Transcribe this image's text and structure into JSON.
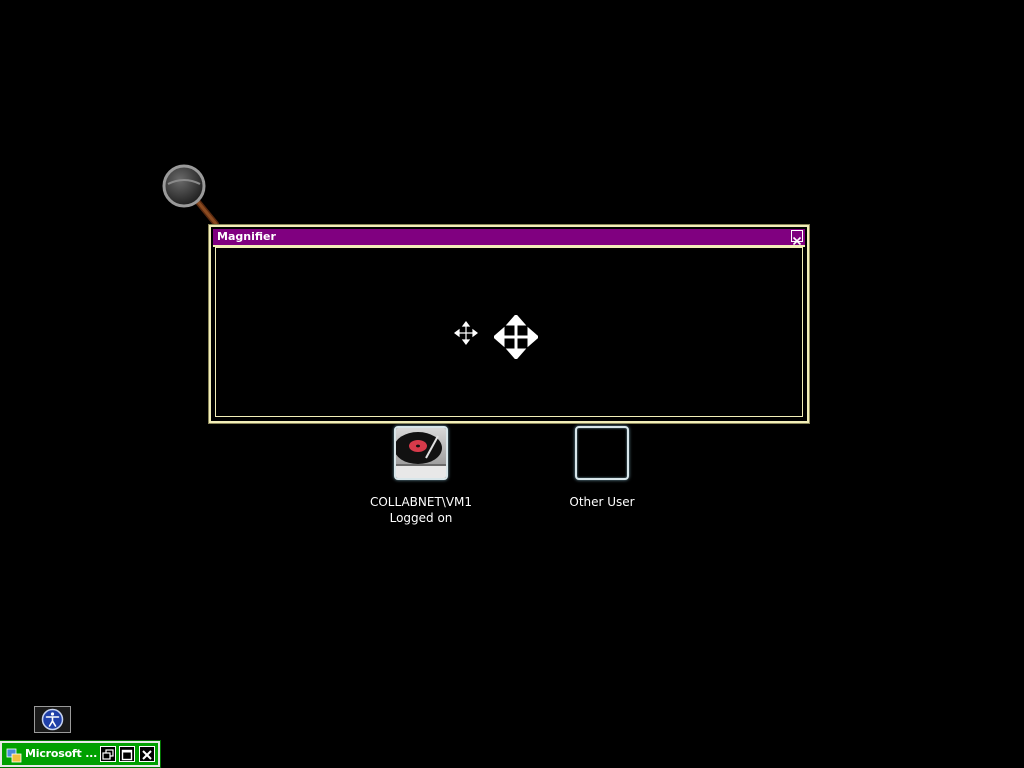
{
  "magnifier": {
    "title": "Magnifier",
    "close_icon": "close-icon",
    "titlebar_color": "#800080",
    "frame_color": "#f2eeb8",
    "magnified_cursor_icon": "move-cursor-icon"
  },
  "users": [
    {
      "name": "COLLABNET\\VM1",
      "status": "Logged on",
      "picture_icon": "turntable-icon"
    },
    {
      "name": "Other User",
      "status": "",
      "picture_icon": "blank-user-icon"
    }
  ],
  "ease_of_access": {
    "icon": "ease-of-access-icon"
  },
  "minimized_window": {
    "title": "Microsoft ...",
    "icon": "application-icon",
    "background_color": "#00a000",
    "buttons": [
      "restore-icon",
      "maximize-icon",
      "close-icon"
    ]
  },
  "magnifier_lens_icon": "magnifying-glass-icon"
}
